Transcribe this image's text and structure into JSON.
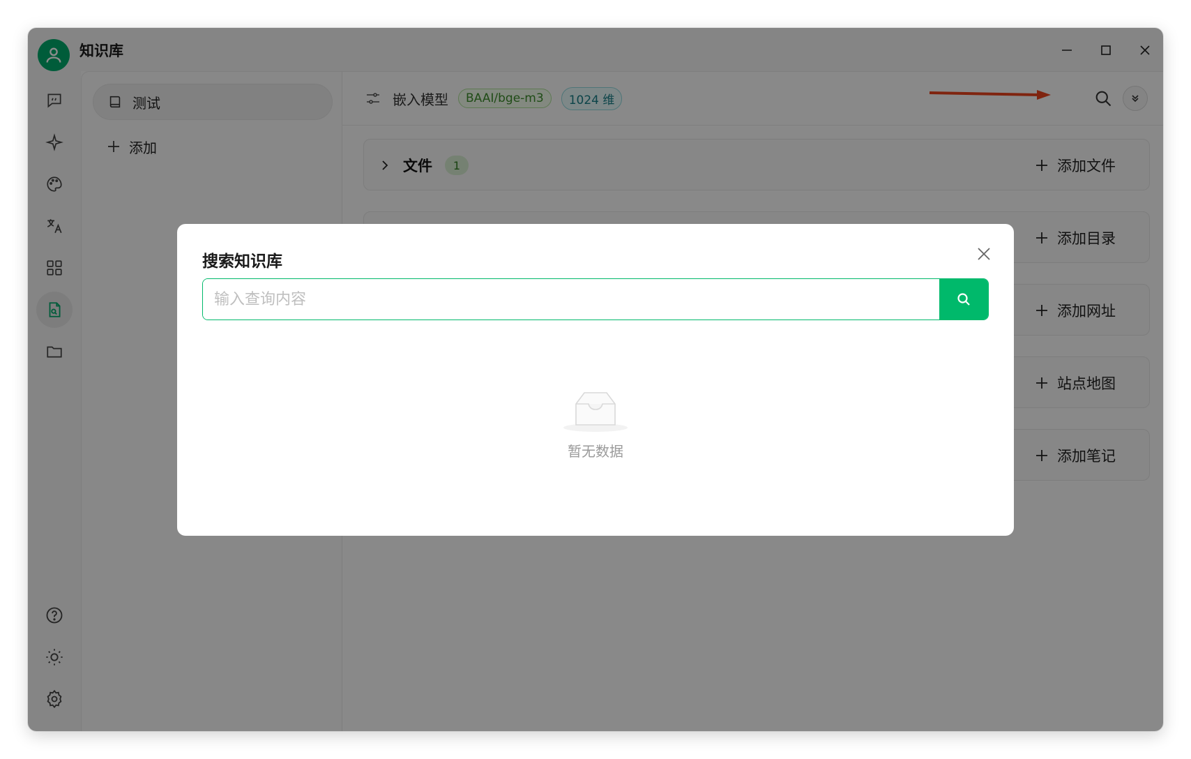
{
  "app": {
    "title": "知识库"
  },
  "rail": {
    "items": [
      {
        "name": "chat-icon"
      },
      {
        "name": "sparkle-icon"
      },
      {
        "name": "palette-icon"
      },
      {
        "name": "translate-icon"
      },
      {
        "name": "apps-grid-icon"
      },
      {
        "name": "knowledge-icon",
        "active": true
      },
      {
        "name": "folder-icon"
      },
      {
        "name": "help-icon"
      },
      {
        "name": "theme-sun-icon"
      },
      {
        "name": "settings-icon"
      }
    ]
  },
  "kb_list": {
    "items": [
      {
        "label": "测试"
      }
    ],
    "add_label": "添加"
  },
  "header": {
    "embedding_label": "嵌入模型",
    "model_tag": "BAAI/bge-m3",
    "dimension_tag": "1024 维"
  },
  "sections": [
    {
      "title": "文件",
      "count": "1",
      "action": "添加文件"
    },
    {
      "title": "",
      "count": "",
      "action": "添加目录"
    },
    {
      "title": "",
      "count": "",
      "action": "添加网址"
    },
    {
      "title": "",
      "count": "",
      "action": "站点地图"
    },
    {
      "title": "",
      "count": "",
      "action": "添加笔记"
    }
  ],
  "dialog": {
    "title": "搜索知识库",
    "search_placeholder": "输入查询内容",
    "search_value": "",
    "empty_text": "暂无数据"
  },
  "colors": {
    "accent": "#00b96b",
    "annotation_arrow": "#e8431c"
  }
}
